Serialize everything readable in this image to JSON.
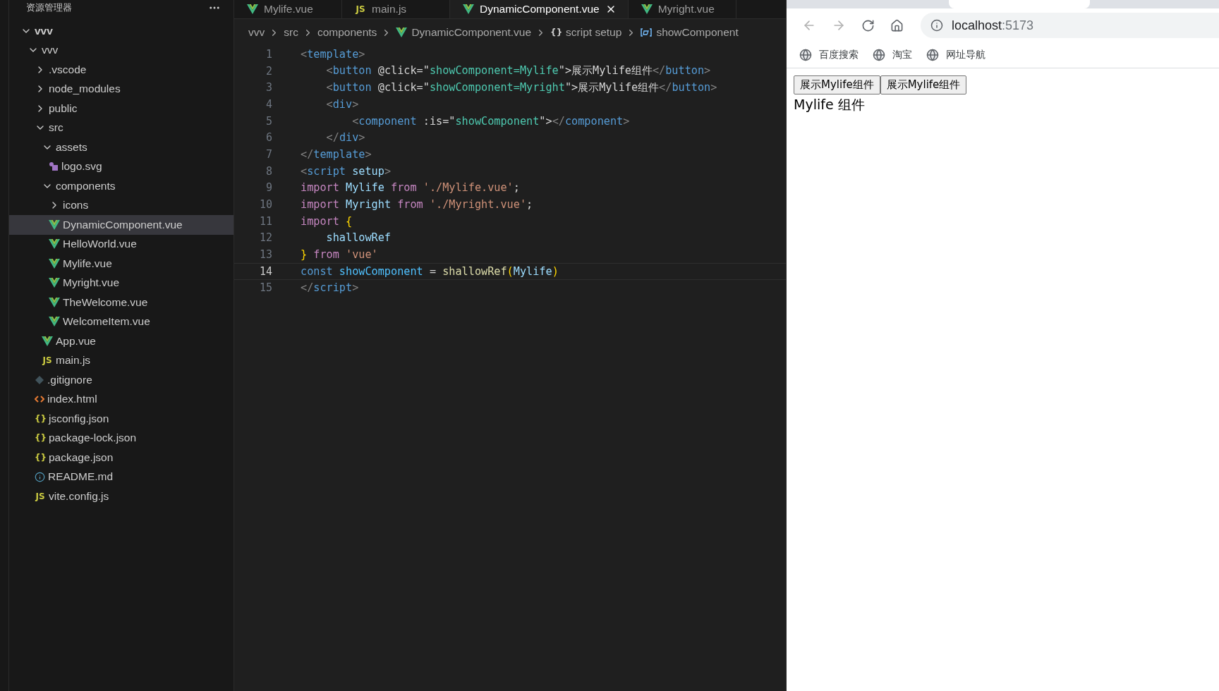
{
  "explorer": {
    "title": "资源管理器",
    "tree": [
      {
        "label": "vvv",
        "kind": "root",
        "expanded": true,
        "selected": false,
        "children": [
          {
            "label": "vvv",
            "kind": "folder",
            "expanded": true,
            "selected": false,
            "children": [
              {
                "label": ".vscode",
                "kind": "folder",
                "expanded": false,
                "selected": false
              },
              {
                "label": "node_modules",
                "kind": "folder",
                "expanded": false,
                "selected": false
              },
              {
                "label": "public",
                "kind": "folder",
                "expanded": false,
                "selected": false
              },
              {
                "label": "src",
                "kind": "folder",
                "expanded": true,
                "selected": false,
                "children": [
                  {
                    "label": "assets",
                    "kind": "folder",
                    "expanded": true,
                    "selected": false,
                    "children": [
                      {
                        "label": "logo.svg",
                        "kind": "svg",
                        "selected": false
                      }
                    ]
                  },
                  {
                    "label": "components",
                    "kind": "folder",
                    "expanded": true,
                    "selected": false,
                    "children": [
                      {
                        "label": "icons",
                        "kind": "folder",
                        "expanded": false,
                        "selected": false
                      },
                      {
                        "label": "DynamicComponent.vue",
                        "kind": "vue",
                        "selected": true
                      },
                      {
                        "label": "HelloWorld.vue",
                        "kind": "vue",
                        "selected": false
                      },
                      {
                        "label": "Mylife.vue",
                        "kind": "vue",
                        "selected": false
                      },
                      {
                        "label": "Myright.vue",
                        "kind": "vue",
                        "selected": false
                      },
                      {
                        "label": "TheWelcome.vue",
                        "kind": "vue",
                        "selected": false
                      },
                      {
                        "label": "WelcomeItem.vue",
                        "kind": "vue",
                        "selected": false
                      }
                    ]
                  },
                  {
                    "label": "App.vue",
                    "kind": "vue",
                    "selected": false
                  },
                  {
                    "label": "main.js",
                    "kind": "js",
                    "icon_text": "JS",
                    "selected": false
                  }
                ]
              },
              {
                "label": ".gitignore",
                "kind": "git",
                "selected": false
              },
              {
                "label": "index.html",
                "kind": "html",
                "selected": false
              },
              {
                "label": "jsconfig.json",
                "kind": "json",
                "icon_text": "{}",
                "selected": false
              },
              {
                "label": "package-lock.json",
                "kind": "json",
                "icon_text": "{}",
                "selected": false
              },
              {
                "label": "package.json",
                "kind": "json",
                "icon_text": "{}",
                "selected": false
              },
              {
                "label": "README.md",
                "kind": "info",
                "selected": false
              },
              {
                "label": "vite.config.js",
                "kind": "js",
                "icon_text": "JS",
                "selected": false
              }
            ]
          }
        ]
      }
    ]
  },
  "tabs": [
    {
      "label": "Mylife.vue",
      "kind": "vue",
      "selected": false
    },
    {
      "label": "main.js",
      "kind": "js",
      "icon_text": "JS",
      "selected": false
    },
    {
      "label": "DynamicComponent.vue",
      "kind": "vue",
      "selected": true
    },
    {
      "label": "Myright.vue",
      "kind": "vue",
      "selected": false
    }
  ],
  "breadcrumb": [
    {
      "label": "vvv",
      "kind": "folder"
    },
    {
      "label": "src",
      "kind": "folder"
    },
    {
      "label": "components",
      "kind": "folder"
    },
    {
      "label": "DynamicComponent.vue",
      "kind": "vue"
    },
    {
      "label": "script setup",
      "kind": "braces",
      "icon_text": "{}"
    },
    {
      "label": "showComponent",
      "kind": "variable"
    }
  ],
  "code": [
    {
      "number": "1",
      "current": false,
      "tokens": [
        {
          "text": "<",
          "kind": "punct"
        },
        {
          "text": "template",
          "kind": "tag"
        },
        {
          "text": ">",
          "kind": "punct"
        }
      ]
    },
    {
      "number": "2",
      "current": false,
      "tokens": [
        {
          "text": "    <",
          "kind": "punct"
        },
        {
          "text": "button",
          "kind": "tag"
        },
        {
          "text": " @click=\"",
          "kind": "plain"
        },
        {
          "text": "showComponent=Mylife",
          "kind": "value"
        },
        {
          "text": "\">展示Mylife组件",
          "kind": "plain"
        },
        {
          "text": "</",
          "kind": "punct"
        },
        {
          "text": "button",
          "kind": "tag"
        },
        {
          "text": ">",
          "kind": "punct"
        }
      ]
    },
    {
      "number": "3",
      "current": false,
      "tokens": [
        {
          "text": "    <",
          "kind": "punct"
        },
        {
          "text": "button",
          "kind": "tag"
        },
        {
          "text": " @click=\"",
          "kind": "plain"
        },
        {
          "text": "showComponent=Myright",
          "kind": "value"
        },
        {
          "text": "\">展示Mylife组件",
          "kind": "plain"
        },
        {
          "text": "</",
          "kind": "punct"
        },
        {
          "text": "button",
          "kind": "tag"
        },
        {
          "text": ">",
          "kind": "punct"
        }
      ]
    },
    {
      "number": "4",
      "current": false,
      "tokens": [
        {
          "text": "    <",
          "kind": "punct"
        },
        {
          "text": "div",
          "kind": "tag"
        },
        {
          "text": ">",
          "kind": "punct"
        }
      ]
    },
    {
      "number": "5",
      "current": false,
      "tokens": [
        {
          "text": "        <",
          "kind": "punct"
        },
        {
          "text": "component",
          "kind": "tag"
        },
        {
          "text": " :is=\"",
          "kind": "plain"
        },
        {
          "text": "showComponent",
          "kind": "value"
        },
        {
          "text": "\">",
          "kind": "plain"
        },
        {
          "text": "</",
          "kind": "punct"
        },
        {
          "text": "component",
          "kind": "tag"
        },
        {
          "text": ">",
          "kind": "punct"
        }
      ]
    },
    {
      "number": "6",
      "current": false,
      "tokens": [
        {
          "text": "    </",
          "kind": "punct"
        },
        {
          "text": "div",
          "kind": "tag"
        },
        {
          "text": ">",
          "kind": "punct"
        }
      ]
    },
    {
      "number": "7",
      "current": false,
      "tokens": [
        {
          "text": "</",
          "kind": "punct"
        },
        {
          "text": "template",
          "kind": "tag"
        },
        {
          "text": ">",
          "kind": "punct"
        }
      ]
    },
    {
      "number": "8",
      "current": false,
      "tokens": [
        {
          "text": "<",
          "kind": "punct"
        },
        {
          "text": "script",
          "kind": "tag"
        },
        {
          "text": " setup",
          "kind": "ident"
        },
        {
          "text": ">",
          "kind": "punct"
        }
      ]
    },
    {
      "number": "9",
      "current": false,
      "tokens": [
        {
          "text": "import",
          "kind": "keyword"
        },
        {
          "text": " Mylife ",
          "kind": "ident"
        },
        {
          "text": "from",
          "kind": "keyword"
        },
        {
          "text": " './Mylife.vue'",
          "kind": "string"
        },
        {
          "text": ";",
          "kind": "plain"
        }
      ]
    },
    {
      "number": "10",
      "current": false,
      "tokens": [
        {
          "text": "import",
          "kind": "keyword"
        },
        {
          "text": " Myright ",
          "kind": "ident"
        },
        {
          "text": "from",
          "kind": "keyword"
        },
        {
          "text": " './Myright.vue'",
          "kind": "string"
        },
        {
          "text": ";",
          "kind": "plain"
        }
      ]
    },
    {
      "number": "11",
      "current": false,
      "tokens": [
        {
          "text": "import ",
          "kind": "keyword"
        },
        {
          "text": "{",
          "kind": "brace"
        }
      ]
    },
    {
      "number": "12",
      "current": false,
      "tokens": [
        {
          "text": "    shallowRef",
          "kind": "ident"
        }
      ]
    },
    {
      "number": "13",
      "current": false,
      "tokens": [
        {
          "text": "}",
          "kind": "brace"
        },
        {
          "text": " from",
          "kind": "keyword"
        },
        {
          "text": " 'vue'",
          "kind": "string"
        }
      ]
    },
    {
      "number": "14",
      "current": true,
      "tokens": [
        {
          "text": "const",
          "kind": "const"
        },
        {
          "text": " showComponent",
          "kind": "variable"
        },
        {
          "text": " = ",
          "kind": "plain"
        },
        {
          "text": "shallowRef",
          "kind": "func"
        },
        {
          "text": "(",
          "kind": "brace"
        },
        {
          "text": "Mylife",
          "kind": "ident"
        },
        {
          "text": ")",
          "kind": "brace"
        }
      ]
    },
    {
      "number": "15",
      "current": false,
      "tokens": [
        {
          "text": "</",
          "kind": "punct"
        },
        {
          "text": "script",
          "kind": "tag"
        },
        {
          "text": ">",
          "kind": "punct"
        }
      ]
    }
  ],
  "browser": {
    "nav": [
      {
        "kind": "back",
        "disabled": true
      },
      {
        "kind": "forward",
        "disabled": true
      },
      {
        "kind": "reload",
        "disabled": false
      },
      {
        "kind": "home",
        "disabled": false
      }
    ],
    "address": {
      "host": "localhost",
      "port": ":5173"
    },
    "bookmarks": [
      "百度搜索",
      "淘宝",
      "网址导航"
    ],
    "page": {
      "buttons": [
        "展示Mylife组件",
        "展示Mylife组件"
      ],
      "text": "Mylife 组件"
    }
  }
}
